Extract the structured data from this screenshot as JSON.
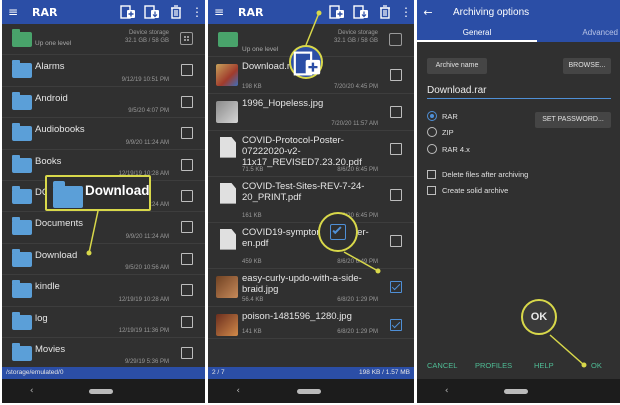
{
  "app": {
    "title": "RAR",
    "menu_icon": "hamburger-icon",
    "toolbar_icons": [
      "archive-icon",
      "extract-icon",
      "delete-icon",
      "more-vertical-icon"
    ]
  },
  "panel1": {
    "up_row": {
      "label": "Up one level",
      "device": "Device storage",
      "space": "32.1 GB / 58 GB"
    },
    "folders": [
      {
        "name": "Alarms",
        "date": "9/12/19 10:51 PM"
      },
      {
        "name": "Android",
        "date": "9/5/20 4:07 PM"
      },
      {
        "name": "Audiobooks",
        "date": "9/9/20 11:24 AM"
      },
      {
        "name": "Books",
        "date": "12/19/19 10:28 AM"
      },
      {
        "name": "DCIM",
        "date": "9/9/20 11:24 AM"
      },
      {
        "name": "Documents",
        "date": "9/9/20 11:24 AM"
      },
      {
        "name": "Download",
        "date": "9/5/20 10:56 AM"
      },
      {
        "name": "kindle",
        "date": "12/19/19 10:28 AM"
      },
      {
        "name": "log",
        "date": "12/19/19 11:36 PM"
      },
      {
        "name": "Movies",
        "date": "9/29/19 5:36 PM"
      }
    ],
    "status_path": "/storage/emulated/0",
    "callout_label": "Download"
  },
  "panel2": {
    "up_row": {
      "label": "Up one level",
      "device": "Device storage",
      "space": "32.1 GB / 58 GB"
    },
    "files": [
      {
        "name": "Download.rar",
        "size": "198 KB",
        "date": "7/20/20 4:45 PM",
        "checked": false,
        "kind": "archive"
      },
      {
        "name": "1996_Hopeless.jpg",
        "size": "",
        "date": "7/20/20 11:57 AM",
        "checked": false,
        "kind": "image"
      },
      {
        "name": "COVID-Protocol-Poster-07222020-v2-11x17_REVISED7.23.20.pdf",
        "size": "71.5 KB",
        "date": "8/6/20 6:45 PM",
        "checked": false,
        "kind": "doc"
      },
      {
        "name": "COVID-Test-Sites-REV-7-24-20_PRINT.pdf",
        "size": "161 KB",
        "date": "8/6/20 6:45 PM",
        "checked": false,
        "kind": "doc"
      },
      {
        "name": "COVID19-symptoms-checker-en.pdf",
        "size": "459 KB",
        "date": "8/6/20 6:49 PM",
        "checked": false,
        "kind": "doc"
      },
      {
        "name": "easy-curly-updo-with-a-side-braid.jpg",
        "size": "56.4 KB",
        "date": "6/8/20 1:29 PM",
        "checked": true,
        "kind": "image"
      },
      {
        "name": "poison-1481596_1280.jpg",
        "size": "141 KB",
        "date": "6/8/20 1:29 PM",
        "checked": true,
        "kind": "image"
      }
    ],
    "status_left": "2 / 7",
    "status_right": "198 KB / 1.57 MB"
  },
  "panel3": {
    "title": "Archiving options",
    "back_icon": "arrow-left-icon",
    "tabs": [
      "General",
      "Advanced"
    ],
    "archive_name_button": "Archive name",
    "browse_button": "BROWSE...",
    "archive_name_value": "Download.rar",
    "formats": [
      {
        "label": "RAR",
        "selected": true
      },
      {
        "label": "ZIP",
        "selected": false
      },
      {
        "label": "RAR 4.x",
        "selected": false
      }
    ],
    "set_password_button": "SET PASSWORD...",
    "options": [
      {
        "label": "Delete files after archiving",
        "checked": false
      },
      {
        "label": "Create solid archive",
        "checked": false
      }
    ],
    "footer_buttons": [
      "CANCEL",
      "PROFILES",
      "HELP",
      "OK"
    ],
    "ok_callout": "OK"
  },
  "nav": {
    "back_icon": "chevron-left-icon",
    "home_icon": "home-pill-icon"
  },
  "colors": {
    "appbar": "#2b4ea6",
    "background": "#303030",
    "folder": "#5b9fd8",
    "accent": "#4f8fd6",
    "footer_text": "#4fbd96",
    "highlight": "#d8d84a"
  }
}
